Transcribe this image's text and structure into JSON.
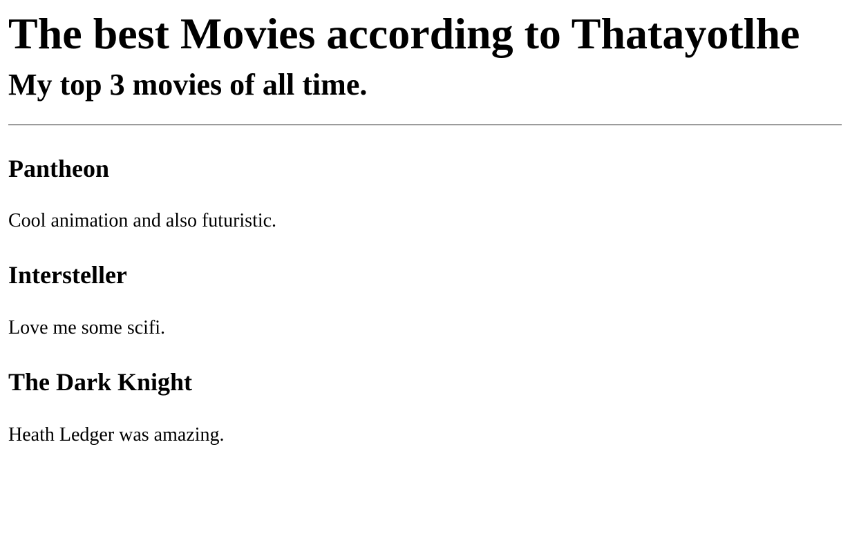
{
  "page": {
    "heading": "The best Movies according to Thatayotlhe",
    "subheading": "My top 3 movies of all time."
  },
  "movies": [
    {
      "title": "Pantheon",
      "description": "Cool animation and also futuristic."
    },
    {
      "title": "Intersteller",
      "description": "Love me some scifi."
    },
    {
      "title": "The Dark Knight",
      "description": "Heath Ledger was amazing."
    }
  ],
  "colors": {
    "text": "#000000",
    "background": "#ffffff",
    "rule": "#7a7a7a"
  }
}
